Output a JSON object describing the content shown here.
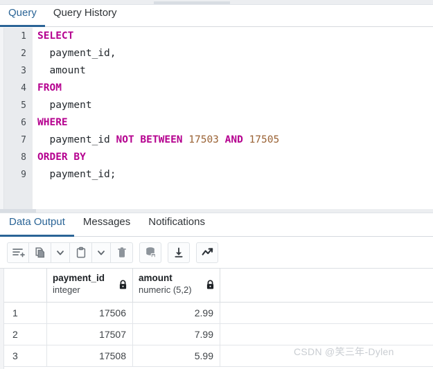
{
  "window": {
    "query_tabs": [
      {
        "label": "Query",
        "active": true
      },
      {
        "label": "Query History",
        "active": false
      }
    ]
  },
  "editor": {
    "language": "sql",
    "lines": [
      {
        "n": "1",
        "tokens": [
          {
            "t": "kw",
            "s": "SELECT"
          }
        ]
      },
      {
        "n": "2",
        "tokens": [
          {
            "t": "idn",
            "s": "  payment_id,"
          }
        ]
      },
      {
        "n": "3",
        "tokens": [
          {
            "t": "idn",
            "s": "  amount"
          }
        ]
      },
      {
        "n": "4",
        "tokens": [
          {
            "t": "kw",
            "s": "FROM"
          }
        ]
      },
      {
        "n": "5",
        "tokens": [
          {
            "t": "idn",
            "s": "  payment"
          }
        ]
      },
      {
        "n": "6",
        "tokens": [
          {
            "t": "kw",
            "s": "WHERE"
          }
        ]
      },
      {
        "n": "7",
        "tokens": [
          {
            "t": "idn",
            "s": "  payment_id "
          },
          {
            "t": "kw",
            "s": "NOT BETWEEN "
          },
          {
            "t": "num",
            "s": "17503"
          },
          {
            "t": "kw",
            "s": " AND "
          },
          {
            "t": "num",
            "s": "17505"
          }
        ]
      },
      {
        "n": "8",
        "tokens": [
          {
            "t": "kw",
            "s": "ORDER BY"
          }
        ]
      },
      {
        "n": "9",
        "tokens": [
          {
            "t": "idn",
            "s": "  payment_id;"
          }
        ]
      }
    ],
    "full_text": "SELECT\n  payment_id,\n  amount\nFROM\n  payment\nWHERE\n  payment_id NOT BETWEEN 17503 AND 17505\nORDER BY\n  payment_id;"
  },
  "output": {
    "tabs": [
      {
        "label": "Data Output",
        "active": true
      },
      {
        "label": "Messages",
        "active": false
      },
      {
        "label": "Notifications",
        "active": false
      }
    ],
    "toolbar": [
      {
        "name": "add-row-icon",
        "title": "Add row"
      },
      {
        "name": "copy-icon",
        "title": "Copy"
      },
      {
        "name": "chevron-down-icon",
        "title": "Copy options"
      },
      {
        "name": "paste-icon",
        "title": "Paste"
      },
      {
        "name": "chevron-down-icon",
        "title": "Paste options"
      },
      {
        "name": "trash-icon",
        "title": "Delete"
      },
      {
        "name": "save-data-icon",
        "title": "Save data changes"
      },
      {
        "name": "download-icon",
        "title": "Download as CSV"
      },
      {
        "name": "graph-visualiser-icon",
        "title": "Graph visualiser"
      }
    ],
    "grid": {
      "columns": [
        {
          "key": "rownum",
          "name": "",
          "type": "",
          "locked": false
        },
        {
          "key": "payment_id",
          "name": "payment_id",
          "type": "integer",
          "locked": true
        },
        {
          "key": "amount",
          "name": "amount",
          "type": "numeric (5,2)",
          "locked": true
        }
      ],
      "rows": [
        {
          "rownum": "1",
          "payment_id": "17506",
          "amount": "2.99"
        },
        {
          "rownum": "2",
          "payment_id": "17507",
          "amount": "7.99"
        },
        {
          "rownum": "3",
          "payment_id": "17508",
          "amount": "5.99"
        }
      ]
    }
  },
  "watermark": {
    "text": "CSDN @笑三年-Dylen"
  },
  "colors": {
    "accent": "#2a6496",
    "keyword": "#b5008f",
    "number": "#9a6234",
    "gutter_bg": "#e9ebee",
    "watermark": "#c9cdd2"
  }
}
